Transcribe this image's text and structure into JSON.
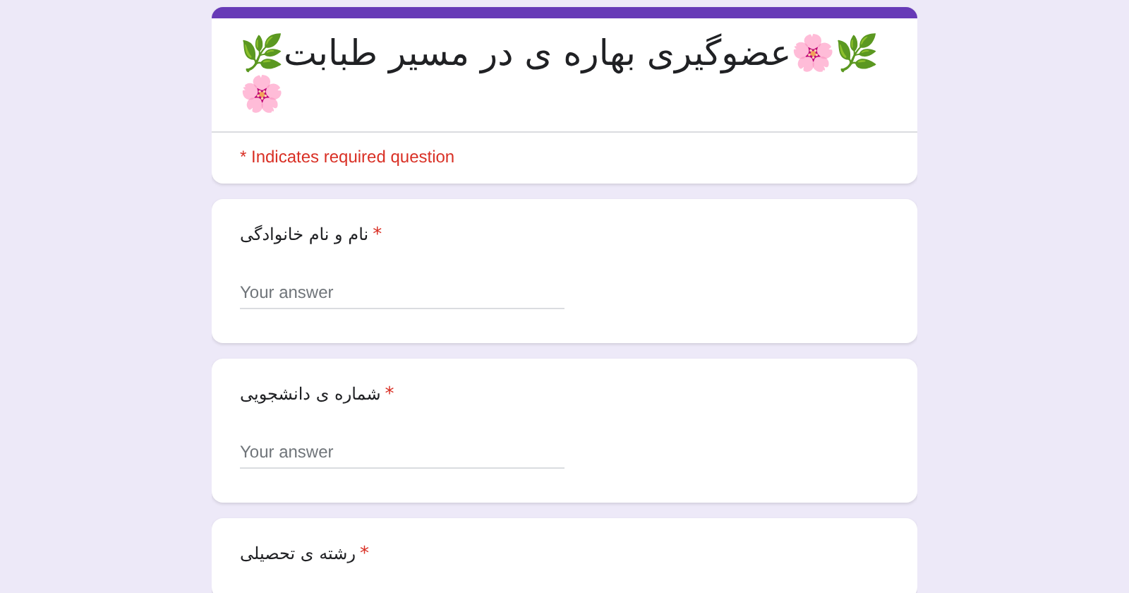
{
  "form": {
    "title": "🌿🌸عضوگیری بهاره ی در مسیر طبابت🌿🌸",
    "required_note": "* Indicates required question"
  },
  "required_mark": "*",
  "questions": [
    {
      "label": "نام و نام خانوادگی",
      "required": true,
      "placeholder": "Your answer"
    },
    {
      "label": "شماره ی دانشجویی",
      "required": true,
      "placeholder": "Your answer"
    },
    {
      "label": "رشته ی تحصیلی",
      "required": true
    }
  ]
}
